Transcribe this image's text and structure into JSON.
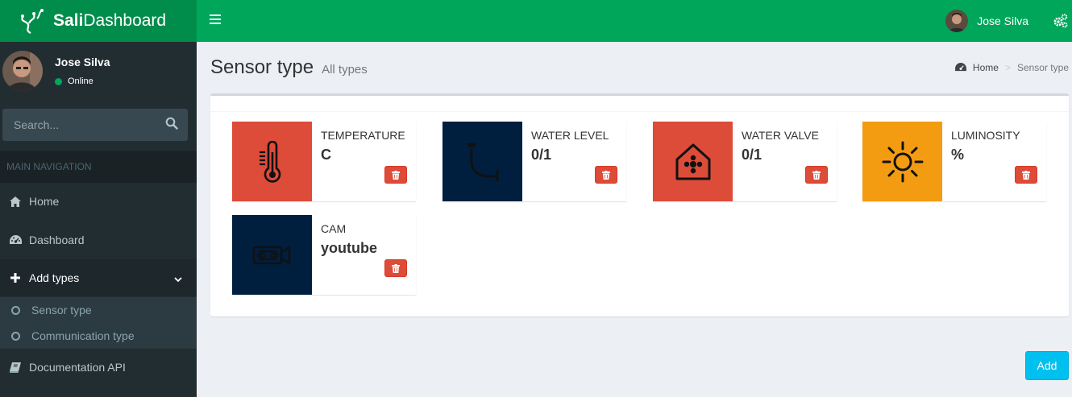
{
  "app": {
    "brand_bold": "Sali",
    "brand_rest": "Dashboard",
    "brand_color": "#008d4c",
    "navbar_color": "#00a65a"
  },
  "header": {
    "username": "Jose Silva",
    "toggle_icon": "hamburger-icon",
    "settings_icon": "gears-icon"
  },
  "sidebar": {
    "user": {
      "name": "Jose Silva",
      "status": "Online"
    },
    "search": {
      "placeholder": "Search..."
    },
    "nav_header": "MAIN NAVIGATION",
    "items": [
      {
        "label": "Home",
        "icon": "home-icon"
      },
      {
        "label": "Dashboard",
        "icon": "dashboard-icon"
      },
      {
        "label": "Add types",
        "icon": "plus-icon"
      },
      {
        "label": "Documentation API",
        "icon": "book-icon"
      }
    ],
    "submenu": [
      {
        "label": "Sensor type",
        "icon": "circle-icon"
      },
      {
        "label": "Communication type",
        "icon": "circle-icon"
      }
    ]
  },
  "page": {
    "title": "Sensor type",
    "subtitle": "All types",
    "breadcrumb": {
      "home": "Home",
      "current": "Sensor type"
    }
  },
  "sensors": [
    {
      "label": "TEMPERATURE",
      "value": "C",
      "color": "#dd4b39",
      "icon": "thermometer-icon"
    },
    {
      "label": "WATER LEVEL",
      "value": "0/1",
      "color": "#001f3f",
      "icon": "water-level-icon"
    },
    {
      "label": "WATER VALVE",
      "value": "0/1",
      "color": "#dd4b39",
      "icon": "water-valve-icon"
    },
    {
      "label": "LUMINOSITY",
      "value": "%",
      "color": "#f39c12",
      "icon": "sun-icon"
    },
    {
      "label": "CAM",
      "value": "youtube",
      "color": "#001f3f",
      "icon": "camera-icon"
    }
  ],
  "actions": {
    "add_label": "Add"
  }
}
